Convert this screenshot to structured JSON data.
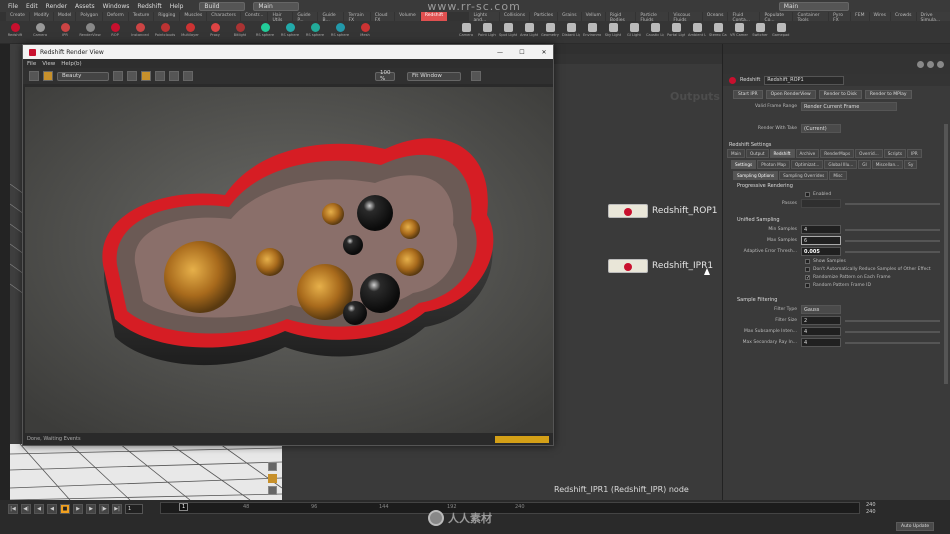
{
  "menubar": {
    "items": [
      "File",
      "Edit",
      "Render",
      "Assets",
      "Windows",
      "Redshift",
      "Help"
    ],
    "build_combo": "Build",
    "desk_combo": "Main",
    "watermark": "www.rr-sc.com",
    "right_combo": "Main"
  },
  "shelf": {
    "tabs": [
      "Create",
      "Modify",
      "Model",
      "Polygon",
      "Deform",
      "Texture",
      "Rigging",
      "Muscles",
      "Characters",
      "Constr...",
      "Hair Utils",
      "Guide P...",
      "Guide B...",
      "Terrain FX",
      "Cloud FX",
      "Volume",
      "Redshift"
    ],
    "right_tabs": [
      "Lights and...",
      "Collisions",
      "Particles",
      "Grains",
      "Vellum",
      "Rigid Bodies",
      "Particle Fluids",
      "Viscous Fluids",
      "Oceans",
      "Fluid Conta...",
      "Populate Co...",
      "Container Tools",
      "Pyro FX",
      "FEM",
      "Wires",
      "Crowds",
      "Drive Simula..."
    ],
    "tools": [
      "Redshift",
      "Camera",
      "IPR",
      "RenderView",
      "ROP",
      "Instanced",
      "Pointclouds",
      "Multilayer",
      "Proxy",
      "Bitlight",
      "RS sphere",
      "RS sphere",
      "RS sphere",
      "RS sphere",
      "Mesh"
    ],
    "right_tools": [
      "Camera",
      "Point Light",
      "Spot Light",
      "Area Light",
      "Geometry Light",
      "Distant Light",
      "Environment Light",
      "Sky Light",
      "GI Light",
      "Caustic Light",
      "Portal Light",
      "Ambient Light",
      "Stereo Camera",
      "VR Camera",
      "Switcher",
      "Gamepad Camera"
    ]
  },
  "render_view": {
    "title": "Redshift Render View",
    "menu": [
      "File",
      "View",
      "Help(b)"
    ],
    "aov": "Beauty",
    "zoom": "100 %",
    "fit": "Fit Window",
    "status": "Done, Waiting Events"
  },
  "network": {
    "header": "Outputs",
    "nodes": [
      {
        "name": "Redshift_ROP1"
      },
      {
        "name": "Redshift_IPR1"
      }
    ],
    "footer": "Redshift_IPR1 (Redshift_IPR) node"
  },
  "params": {
    "node_type": "Redshift",
    "node_name": "Redshift_ROP1",
    "top_buttons": [
      "Start IPR",
      "Open RenderView",
      "Render to Disk",
      "Render to MPlay"
    ],
    "valid_frame_label": "Valid Frame Range",
    "valid_frame_value": "Render Current Frame",
    "render_with_take_label": "Render With Take",
    "render_with_take_value": "(Current)",
    "settings_header": "Redshift Settings",
    "tabs1": [
      "Main",
      "Output",
      "Redshift",
      "Archive",
      "RenderMaps",
      "Overrid...",
      "Scripts",
      "IPR"
    ],
    "tabs2": [
      "Settings",
      "Photon Map",
      "Optimizat...",
      "Global Illu...",
      "GI",
      "Miscellan...",
      "Sy"
    ],
    "tabs3": [
      "Sampling Options",
      "Sampling Overrides",
      "Misc"
    ],
    "prog_header": "Progressive Rendering",
    "enabled": "Enabled",
    "passes": "Passes",
    "unified_header": "Unified Sampling",
    "min_samples_label": "Min Samples",
    "min_samples": "4",
    "max_samples_label": "Max Samples",
    "max_samples": "6",
    "adaptive_label": "Adaptive Error Thresh...",
    "adaptive": "0.005",
    "checks": [
      {
        "label": "Show Samples",
        "checked": false
      },
      {
        "label": "Don't Automatically Reduce Samples of Other Effect",
        "checked": false
      },
      {
        "label": "Randomize Pattern on Each Frame",
        "checked": true
      },
      {
        "label": "Random Pattern Frame ID",
        "checked": false
      }
    ],
    "filter_header": "Sample Filtering",
    "filter_type_label": "Filter Type",
    "filter_type": "Gauss",
    "filter_size_label": "Filter Size",
    "filter_size": "2",
    "max_sub_label": "Max Subsample Inten...",
    "max_sub": "4",
    "max_sec_label": "Max Secondary Ray In...",
    "max_sec": "4"
  },
  "timeline": {
    "frame": "1",
    "start": "1",
    "ticks": [
      "1",
      "48",
      "96",
      "144",
      "192",
      "240"
    ],
    "end1": "240",
    "end2": "240",
    "auto_update": "Auto Update",
    "logo_text": "人人素材"
  },
  "colors": {
    "accent": "#e05050",
    "node_red": "#c8102e",
    "play": "#f0a020"
  }
}
